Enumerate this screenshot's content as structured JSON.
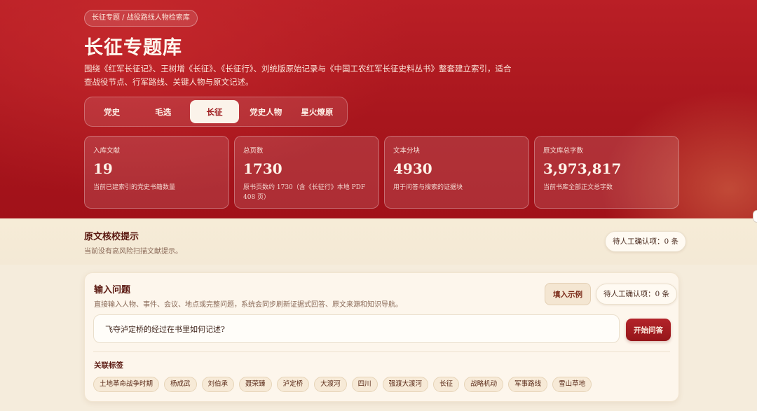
{
  "breadcrumb": "长征专题 / 战役路线人物检索库",
  "header": {
    "title": "长征专题库",
    "description": "围绕《红军长征记》、王树增《长征》、《长征行》、刘统版原始记录与《中国工农红军长征史料丛书》整套建立索引，适合查战役节点、行军路线、关键人物与原文记述。"
  },
  "tabs": [
    {
      "label": "党史",
      "active": false
    },
    {
      "label": "毛选",
      "active": false
    },
    {
      "label": "长征",
      "active": true
    },
    {
      "label": "党史人物",
      "active": false
    },
    {
      "label": "星火燎原",
      "active": false
    }
  ],
  "stats": [
    {
      "label": "入库文献",
      "value": "19",
      "note": "当前已建索引的党史书籍数量"
    },
    {
      "label": "总页数",
      "value": "1730",
      "note": "原书页数约 1730（含《长征行》本地 PDF 408 页）"
    },
    {
      "label": "文本分块",
      "value": "4930",
      "note": "用于问答与搜索的证据块"
    },
    {
      "label": "原文库总字数",
      "value": "3,973,817",
      "note": "当前书库全部正文总字数"
    }
  ],
  "notice": {
    "title": "原文核校提示",
    "subtitle": "当前没有高风险扫描文献提示。",
    "pending_label": "待人工确认项：0 条"
  },
  "ask": {
    "title": "输入问题",
    "subtitle": "直接输入人物、事件、会议、地点或完整问题，系统会同步刷新证据式回答、原文来源和知识导航。",
    "example_button": "填入示例",
    "pending_label": "待人工确认项：0 条",
    "question_value": "飞夺泸定桥的经过在书里如何记述?",
    "submit_button": "开始问答",
    "tags_title": "关联标签",
    "tags": [
      "土地革命战争时期",
      "杨成武",
      "刘伯承",
      "聂荣臻",
      "泸定桥",
      "大渡河",
      "四川",
      "强渡大渡河",
      "长征",
      "战略机动",
      "军事路线",
      "雪山草地"
    ]
  },
  "colors": {
    "hero_red": "#a8161d",
    "accent_dark_red": "#9d1a1d",
    "page_bg": "#f5ecdc"
  }
}
